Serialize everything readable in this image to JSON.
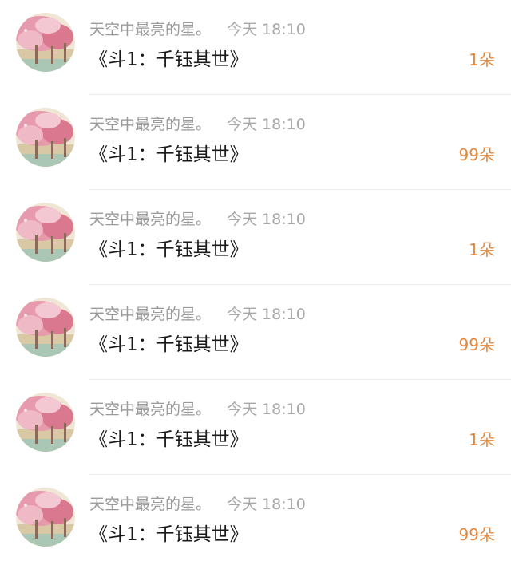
{
  "colors": {
    "accent": "#e3883d",
    "meta_text": "#9a9a9a",
    "title_text": "#1a1a1a",
    "divider": "#ececec"
  },
  "rows": [
    {
      "username": "天空中最亮的星。",
      "time": "今天 18:10",
      "title": "《斗1：千钰其世》",
      "gift": "1朵",
      "avatar_icon": "cherry-blossom-avatar"
    },
    {
      "username": "天空中最亮的星。",
      "time": "今天 18:10",
      "title": "《斗1：千钰其世》",
      "gift": "99朵",
      "avatar_icon": "cherry-blossom-avatar"
    },
    {
      "username": "天空中最亮的星。",
      "time": "今天 18:10",
      "title": "《斗1：千钰其世》",
      "gift": "1朵",
      "avatar_icon": "cherry-blossom-avatar"
    },
    {
      "username": "天空中最亮的星。",
      "time": "今天 18:10",
      "title": "《斗1：千钰其世》",
      "gift": "99朵",
      "avatar_icon": "cherry-blossom-avatar"
    },
    {
      "username": "天空中最亮的星。",
      "time": "今天 18:10",
      "title": "《斗1：千钰其世》",
      "gift": "1朵",
      "avatar_icon": "cherry-blossom-avatar"
    },
    {
      "username": "天空中最亮的星。",
      "time": "今天 18:10",
      "title": "《斗1：千钰其世》",
      "gift": "99朵",
      "avatar_icon": "cherry-blossom-avatar"
    }
  ]
}
